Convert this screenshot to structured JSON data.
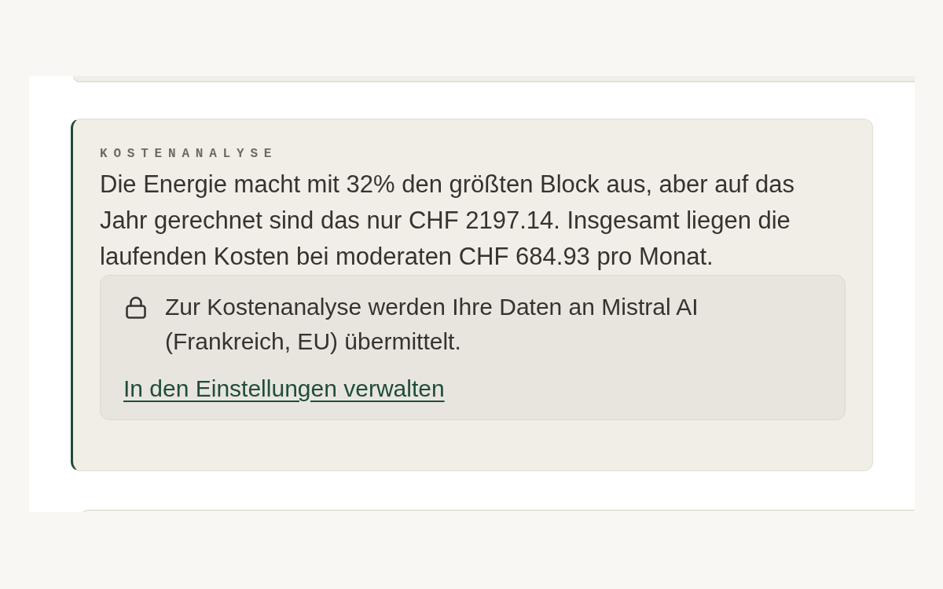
{
  "analysis_card": {
    "label": "KOSTENANALYSE",
    "text": "Die Energie macht mit 32% den größten Block aus, aber auf das Jahr gerechnet sind das nur CHF 2197.14. Insgesamt liegen die laufenden Kosten bei moderaten CHF 684.93 pro Monat.",
    "notice": {
      "text": "Zur Kostenanalyse werden Ihre Daten an Mistral AI (Frankreich, EU) übermittelt.",
      "link": "In den Einstellungen verwalten"
    }
  }
}
